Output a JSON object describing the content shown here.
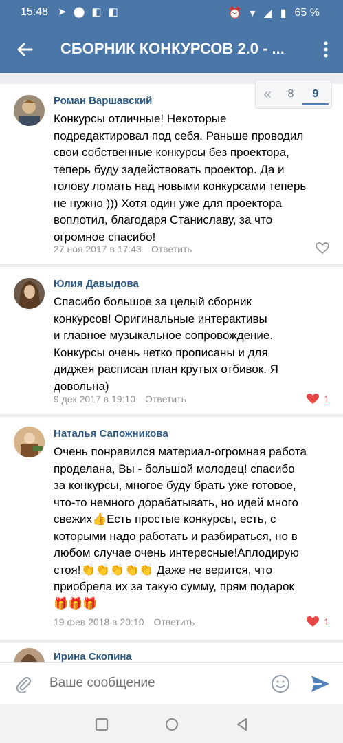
{
  "status": {
    "time": "15:48",
    "battery": "65 %"
  },
  "header": {
    "title": "СБОРНИК КОНКУРСОВ 2.0 - ..."
  },
  "pager": {
    "first": "«",
    "page_prev": "8",
    "page_current": "9"
  },
  "comments": [
    {
      "author": "Роман Варшавский",
      "lines": [
        "Конкурсы отличные!  Некоторые",
        "подредактировал под себя. Раньше проводил",
        "свои собственные конкурсы без проектора,",
        "теперь буду задействовать проектор.  Да и",
        "голову ломать над новыми конкурсами теперь",
        "не нужно ))) Хотя один уже для проектора",
        "воплотил, благодаря Станиславу, за что",
        "огромное спасибо!"
      ],
      "date": "27 ноя 2017 в 17:43",
      "reply": "Ответить",
      "likes": ""
    },
    {
      "author": "Юлия Давыдова",
      "lines": [
        "Спасибо большое за целый сборник",
        "конкурсов! Оригинальные интерактивы",
        "и главное музыкальное сопровождение.",
        "Конкурсы очень четко прописаны и для",
        "диджея расписан план крутых отбивок. Я",
        "довольна)"
      ],
      "date": "9 дек 2017 в 19:10",
      "reply": "Ответить",
      "likes": "1"
    },
    {
      "author": "Наталья Сапожникова",
      "lines": [
        "Очень понравился материал-огромная работа",
        "проделана, Вы - большой молодец! спасибо",
        "за конкурсы, многое буду брать уже готовое,",
        "что-то немного дорабатывать, но идей много",
        "свежих👍Есть простые конкурсы, есть, с",
        "которыми надо работать и разбираться, но в",
        "любом случае очень интересные!Аплодирую",
        "стоя!👏👏👏👏👏 Даже не верится, что",
        "приобрела их за такую сумму, прям подарок",
        "🎁🎁🎁"
      ],
      "date": "19 фев 2018 в 20:10",
      "reply": "Ответить",
      "likes": "1"
    },
    {
      "author": "Ирина Скопина"
    }
  ],
  "input": {
    "placeholder": "Ваше сообщение"
  }
}
